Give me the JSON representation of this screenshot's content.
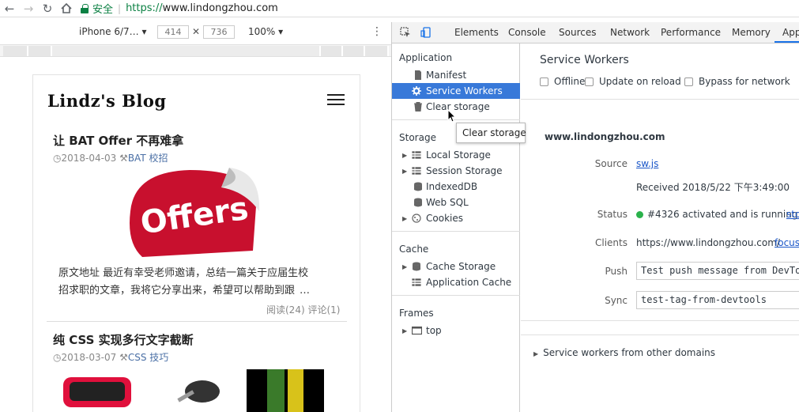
{
  "browser": {
    "secure_label": "安全",
    "url_scheme": "https://",
    "url_host": "www.lindongzhou.com"
  },
  "device_toolbar": {
    "device": "iPhone 6/7…",
    "width": "414",
    "height": "736",
    "zoom": "100%"
  },
  "blog": {
    "logo": "Lindz's Blog",
    "posts": [
      {
        "title": "让 BAT Offer 不再难拿",
        "date": "2018-04-03",
        "tags": "BAT 校招",
        "image_text": "Offers",
        "excerpt_line1": "原文地址 最近有幸受老师邀请，总结一篇关于应届生校",
        "excerpt_line2": "招求职的文章，我将它分享出来，希望可以帮助到跟",
        "ellipsis": "…",
        "reads": "阅读(24)",
        "comments": "评论(1)"
      },
      {
        "title": "纯 CSS 实现多行文字截断",
        "date": "2018-03-07",
        "tags": "CSS 技巧"
      }
    ]
  },
  "devtools": {
    "tabs": [
      "Elements",
      "Console",
      "Sources",
      "Network",
      "Performance",
      "Memory",
      "App"
    ],
    "active_tab": "App",
    "sidebar": {
      "application_title": "Application",
      "application_items": [
        "Manifest",
        "Service Workers",
        "Clear storage"
      ],
      "selected_item": "Service Workers",
      "storage_title": "Storage",
      "storage_items": [
        "Local Storage",
        "Session Storage",
        "IndexedDB",
        "Web SQL",
        "Cookies"
      ],
      "cache_title": "Cache",
      "cache_items": [
        "Cache Storage",
        "Application Cache"
      ],
      "frames_title": "Frames",
      "frames_items": [
        "top"
      ]
    },
    "tooltip": "Clear storage",
    "service_workers": {
      "title": "Service Workers",
      "offline_label": "Offline",
      "update_label": "Update on reload",
      "bypass_label": "Bypass for network",
      "origin": "www.lindongzhou.com",
      "source_label": "Source",
      "source_value": "sw.js",
      "received": "Received 2018/5/22 下午3:49:00",
      "status_label": "Status",
      "status_value": "#4326 activated and is running",
      "status_link": "sto",
      "clients_label": "Clients",
      "clients_value": "https://www.lindongzhou.com/",
      "clients_link": "focus",
      "push_label": "Push",
      "push_value": "Test push message from DevTo",
      "sync_label": "Sync",
      "sync_value": "test-tag-from-devtools",
      "other_domains": "Service workers from other domains"
    },
    "colors": {
      "selected": "#3879d9",
      "link": "#1a56c8",
      "status_dot": "#2bb24c"
    }
  }
}
